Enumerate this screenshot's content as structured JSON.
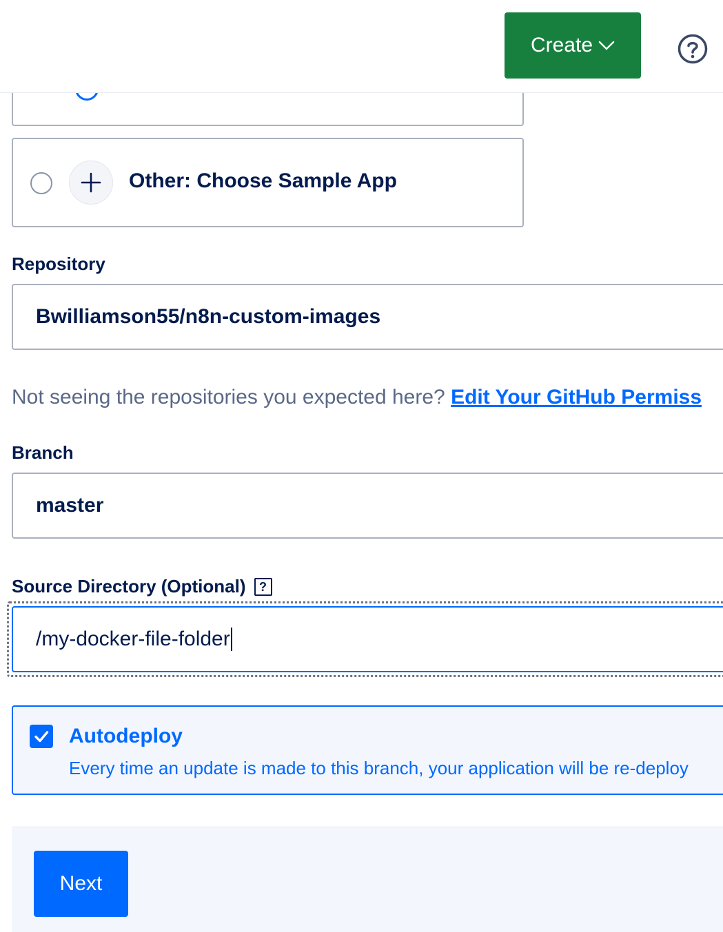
{
  "header": {
    "create_label": "Create",
    "create_icon": "chevron-down-icon",
    "help_icon": "question-circle-icon"
  },
  "source_option": {
    "label": "Other: Choose Sample App",
    "icon": "plus-icon"
  },
  "repository": {
    "label": "Repository",
    "value": "Bwilliamson55/n8n-custom-images"
  },
  "hint": {
    "text": "Not seeing the repositories you expected here?",
    "link": "Edit Your GitHub Permiss"
  },
  "branch": {
    "label": "Branch",
    "value": "master"
  },
  "source_directory": {
    "label": "Source Directory (Optional)",
    "help": "?",
    "value": "/my-docker-file-folder"
  },
  "autodeploy": {
    "title": "Autodeploy",
    "description": "Every time an update is made to this branch, your application will be re-deploy",
    "checked": true
  },
  "footer": {
    "next_label": "Next"
  },
  "colors": {
    "create_green": "#17803f",
    "primary_blue": "#0069ff",
    "text_dark": "#031b4e",
    "muted": "#5b6987"
  }
}
